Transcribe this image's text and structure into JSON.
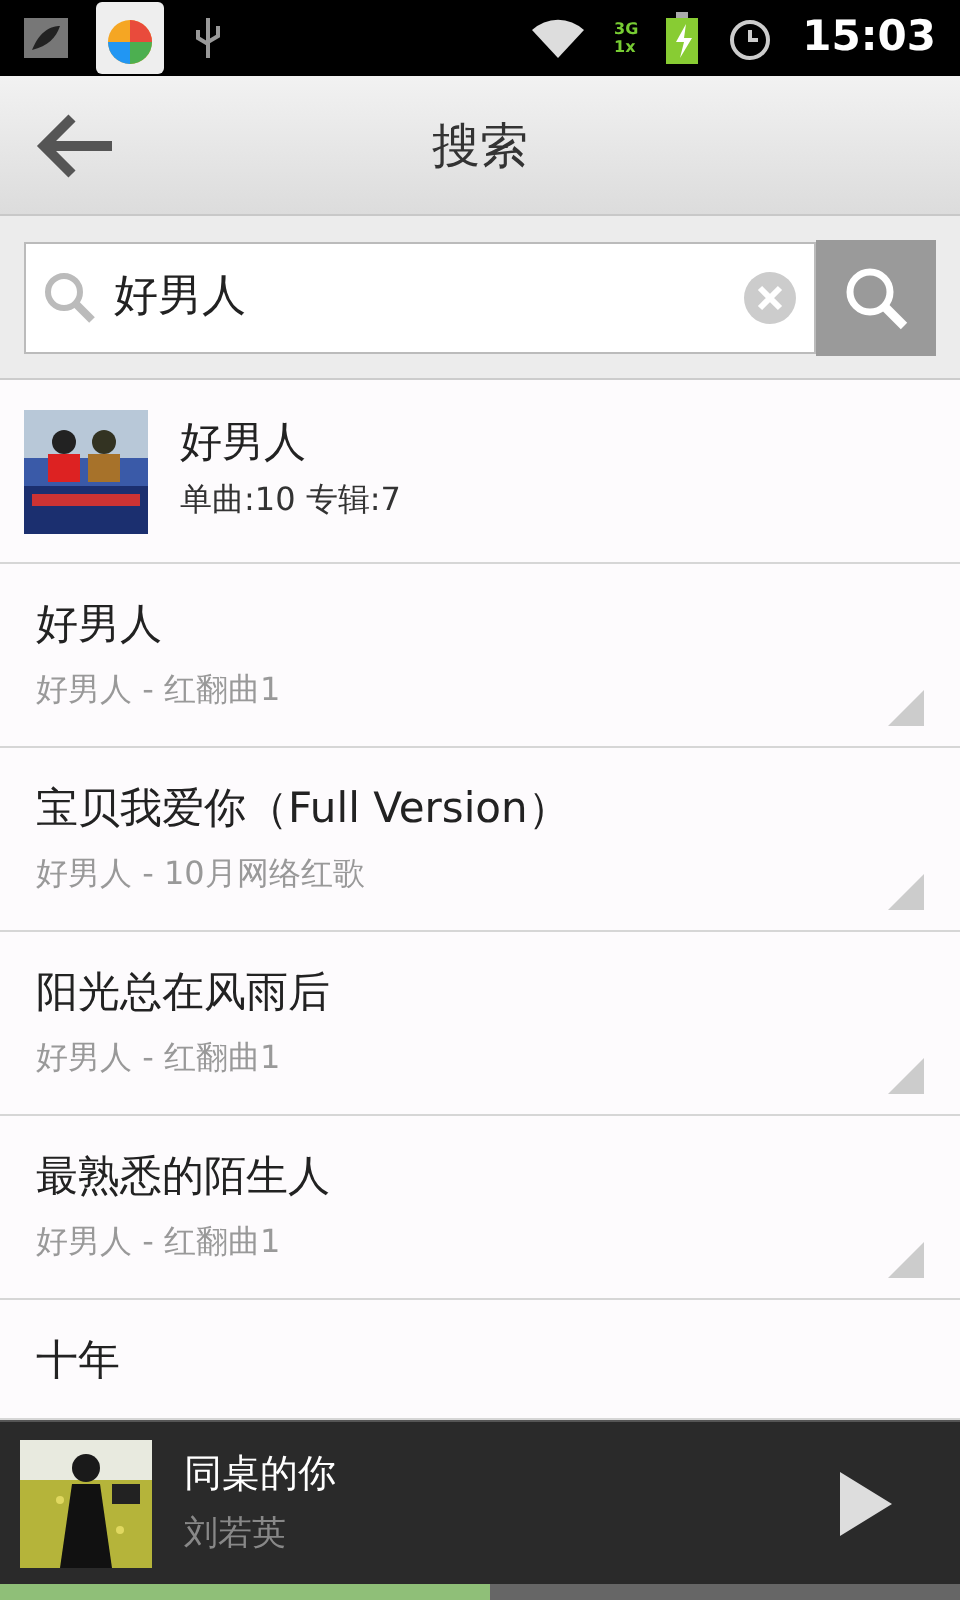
{
  "status_bar": {
    "time": "15:03",
    "signal_labels": [
      "3G",
      "1x"
    ]
  },
  "header": {
    "title": "搜索"
  },
  "search": {
    "value": "好男人"
  },
  "album": {
    "title": "好男人",
    "meta": "单曲:10 专辑:7"
  },
  "songs": [
    {
      "title": "好男人",
      "subtitle": "好男人 - 红翻曲1"
    },
    {
      "title": "宝贝我爱你（Full Version）",
      "subtitle": "好男人 - 10月网络红歌"
    },
    {
      "title": "阳光总在风雨后",
      "subtitle": "好男人 - 红翻曲1"
    },
    {
      "title": "最熟悉的陌生人",
      "subtitle": "好男人 - 红翻曲1"
    },
    {
      "title": "十年"
    }
  ],
  "player": {
    "title": "同桌的你",
    "artist": "刘若英",
    "level": 0.51
  }
}
